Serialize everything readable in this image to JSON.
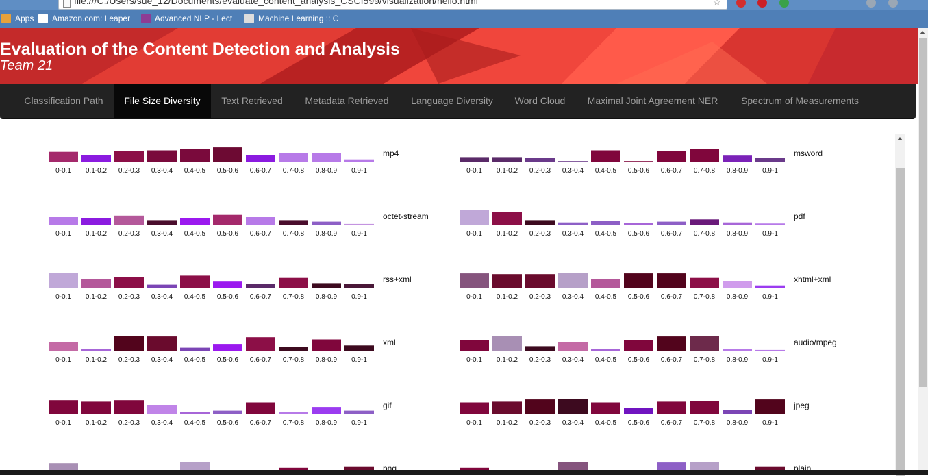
{
  "browser": {
    "url": "file:///C:/Users/sue_12/Documents/evaluate_content_analysis_CSCI599/visualization/hello.html",
    "bookmarks": [
      {
        "label": "Apps",
        "icon": "apps-grid-icon",
        "color": "#e8a13a"
      },
      {
        "label": "Amazon.com: Leaper",
        "icon": "amazon-icon",
        "color": "#ffffff"
      },
      {
        "label": "Advanced NLP - Lect",
        "icon": "nlp-logo-icon",
        "color": "#8e3b94"
      },
      {
        "label": "Machine Learning :: C",
        "icon": "page-icon",
        "color": "#dddddd"
      }
    ]
  },
  "header": {
    "title": "Evaluation of the Content Detection and Analysis",
    "subtitle": "Team 21"
  },
  "nav": {
    "tabs": [
      {
        "label": "Classification Path",
        "active": false
      },
      {
        "label": "File Size Diversity",
        "active": true
      },
      {
        "label": "Text Retrieved",
        "active": false
      },
      {
        "label": "Metadata Retrieved",
        "active": false
      },
      {
        "label": "Language Diversity",
        "active": false
      },
      {
        "label": "Word Cloud",
        "active": false
      },
      {
        "label": "Maximal Joint Agreement NER",
        "active": false
      },
      {
        "label": "Spectrum of Measurements",
        "active": false
      }
    ]
  },
  "chart_data": {
    "type": "bar",
    "categories": [
      "0-0.1",
      "0.1-0.2",
      "0.2-0.3",
      "0.3-0.4",
      "0.4-0.5",
      "0.5-0.6",
      "0.6-0.7",
      "0.7-0.8",
      "0.8-0.9",
      "0.9-1"
    ],
    "ylim": [
      0,
      100
    ],
    "charts": [
      {
        "name": "mp4",
        "values": [
          65,
          45,
          70,
          75,
          85,
          95,
          45,
          55,
          55,
          15
        ],
        "colors": [
          "#a4296b",
          "#8b1be0",
          "#8c0f47",
          "#7a0a3c",
          "#7a0a3c",
          "#6d0a33",
          "#8b1be0",
          "#b77ae8",
          "#b77ae8",
          "#b77ae8"
        ]
      },
      {
        "name": "msword",
        "values": [
          30,
          30,
          25,
          0,
          75,
          0,
          70,
          85,
          40,
          25
        ],
        "colors": [
          "#5a2a68",
          "#5a2a68",
          "#6a3a8a",
          "#6a3a8a",
          "#80063c",
          "#80063c",
          "#80063c",
          "#80063c",
          "#7b22b8",
          "#6a3a8a"
        ]
      },
      {
        "name": "octet-stream",
        "values": [
          50,
          45,
          60,
          30,
          45,
          65,
          50,
          30,
          20,
          5
        ],
        "colors": [
          "#b77ae8",
          "#8b1be0",
          "#b4589a",
          "#4a0d2c",
          "#9b19ef",
          "#a4296b",
          "#b77ae8",
          "#4a0d2c",
          "#8d5fc6",
          "#c494e0"
        ]
      },
      {
        "name": "pdf",
        "values": [
          100,
          85,
          30,
          15,
          25,
          10,
          20,
          35,
          15,
          8
        ],
        "colors": [
          "#c0a8d8",
          "#8c0f47",
          "#3d0a1f",
          "#8d5fc6",
          "#8d5fc6",
          "#a766d8",
          "#8d5fc6",
          "#6a1a7a",
          "#a766d8",
          "#b77ae8"
        ]
      },
      {
        "name": "rss+xml",
        "values": [
          100,
          55,
          70,
          20,
          80,
          40,
          25,
          65,
          30,
          25
        ],
        "colors": [
          "#c0a8d8",
          "#b4589a",
          "#8c0f47",
          "#7b45b5",
          "#8c0f47",
          "#9b19ef",
          "#5a2a68",
          "#8c0f47",
          "#3d0a1f",
          "#4a1838"
        ]
      },
      {
        "name": "xhtml+xml",
        "values": [
          95,
          90,
          90,
          100,
          55,
          95,
          95,
          65,
          45,
          15
        ],
        "colors": [
          "#85547d",
          "#6a0b2d",
          "#6a0b2d",
          "#b6a0c8",
          "#b4589a",
          "#52041c",
          "#52041c",
          "#8c0f47",
          "#d09cec",
          "#9b3cf0"
        ]
      },
      {
        "name": "xml",
        "values": [
          55,
          10,
          100,
          95,
          20,
          45,
          90,
          25,
          75,
          35
        ],
        "colors": [
          "#c46aa5",
          "#a766d8",
          "#52041c",
          "#6a0b2d",
          "#7b45b5",
          "#9b19ef",
          "#8c0f47",
          "#3d0a1f",
          "#80063c",
          "#3d0a1f"
        ]
      },
      {
        "name": "audio/mpeg",
        "values": [
          70,
          100,
          30,
          55,
          10,
          70,
          95,
          100,
          10,
          5
        ],
        "colors": [
          "#80063c",
          "#a88fb4",
          "#3d0a1f",
          "#c46aa5",
          "#a766d8",
          "#80063c",
          "#52041c",
          "#6d2a4b",
          "#b77ae8",
          "#b77ae8"
        ]
      },
      {
        "name": "gif",
        "values": [
          90,
          80,
          90,
          55,
          10,
          20,
          75,
          10,
          45,
          20
        ],
        "colors": [
          "#80063c",
          "#80063c",
          "#80063c",
          "#c084e8",
          "#a766d8",
          "#8d5fc6",
          "#80063c",
          "#b77ae8",
          "#9b3cf0",
          "#8d5fc6"
        ]
      },
      {
        "name": "jpeg",
        "values": [
          75,
          80,
          95,
          100,
          75,
          40,
          80,
          85,
          25,
          95
        ],
        "colors": [
          "#80063c",
          "#6a0b2d",
          "#52041c",
          "#3d0a1f",
          "#80063c",
          "#7014c0",
          "#80063c",
          "#80063c",
          "#7b45b5",
          "#52041c"
        ]
      },
      {
        "name": "png",
        "values": [
          90,
          25,
          10,
          0,
          100,
          15,
          0,
          60,
          0,
          65
        ],
        "colors": [
          "#a88fb4",
          "#a4296b",
          "#c494e0",
          "#c494e0",
          "#b6a0c8",
          "#b4589a",
          "#c494e0",
          "#80063c",
          "#c494e0",
          "#6a0b2d"
        ]
      },
      {
        "name": "plain",
        "values": [
          60,
          30,
          5,
          100,
          40,
          40,
          95,
          100,
          45,
          65
        ],
        "colors": [
          "#80063c",
          "#a4296b",
          "#6a3a8a",
          "#85547d",
          "#80063c",
          "#80063c",
          "#8d5fc6",
          "#b6a0c8",
          "#80063c",
          "#6a0b2d"
        ]
      }
    ]
  }
}
